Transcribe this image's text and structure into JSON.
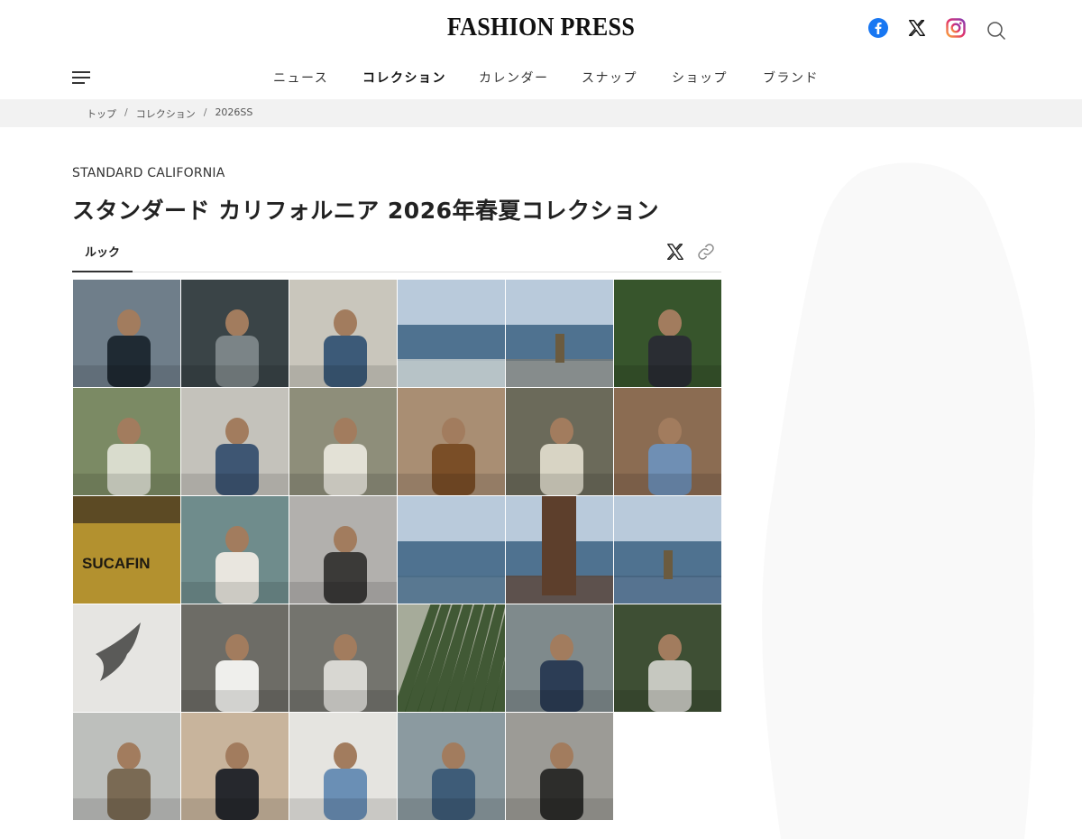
{
  "header": {
    "logo": "FASHION PRESS",
    "social": [
      "facebook-icon",
      "x-icon",
      "instagram-icon"
    ],
    "search_icon": "search-icon"
  },
  "nav": {
    "menu_icon": "menu-icon",
    "items": [
      {
        "label": "ニュース",
        "active": false
      },
      {
        "label": "コレクション",
        "active": true
      },
      {
        "label": "カレンダー",
        "active": false
      },
      {
        "label": "スナップ",
        "active": false
      },
      {
        "label": "ショップ",
        "active": false
      },
      {
        "label": "ブランド",
        "active": false
      }
    ]
  },
  "breadcrumb": [
    "トップ",
    "コレクション",
    "2026SS"
  ],
  "article": {
    "brand_en": "STANDARD CALIFORNIA",
    "title": "スタンダード カリフォルニア 2026年春夏コレクション",
    "tab_label": "ルック",
    "share_icons": [
      "x-share-icon",
      "link-icon"
    ]
  },
  "gallery": {
    "count": 29,
    "photos": [
      {
        "bg": "#6f7e8a",
        "fg": "#1f2a33",
        "label": "",
        "scene": "man-cap"
      },
      {
        "bg": "#3a4447",
        "fg": "#7b8487",
        "label": "",
        "scene": "mat"
      },
      {
        "bg": "#c9c6bc",
        "fg": "#3c5a78",
        "label": "",
        "scene": "car-man"
      },
      {
        "bg": "#6f8fa6",
        "fg": "#d6d8d6",
        "label": "",
        "scene": "coast"
      },
      {
        "bg": "#9fb4c6",
        "fg": "#7c7a74",
        "label": "",
        "scene": "road"
      },
      {
        "bg": "#37552c",
        "fg": "#2a2d33",
        "label": "",
        "scene": "plants-man"
      },
      {
        "bg": "#7b8a64",
        "fg": "#d9dccd",
        "label": "",
        "scene": "grass"
      },
      {
        "bg": "#c4c2bb",
        "fg": "#3e5673",
        "label": "",
        "scene": "sitting"
      },
      {
        "bg": "#8e8e7a",
        "fg": "#e3e1d6",
        "label": "",
        "scene": "sink"
      },
      {
        "bg": "#a98e73",
        "fg": "#7a4e27",
        "label": "",
        "scene": "laundry"
      },
      {
        "bg": "#6b6a5a",
        "fg": "#d8d4c4",
        "label": "",
        "scene": "rail"
      },
      {
        "bg": "#8b6c52",
        "fg": "#6f8fb4",
        "label": "",
        "scene": "bricks"
      },
      {
        "bg": "#5c4a24",
        "fg": "#b3912f",
        "label": "SUCAFIN",
        "scene": "sack"
      },
      {
        "bg": "#6f8c8c",
        "fg": "#e9e6df",
        "label": "",
        "scene": "jacket"
      },
      {
        "bg": "#b2b0ad",
        "fg": "#3b3a38",
        "label": "",
        "scene": "building"
      },
      {
        "bg": "#7c97ad",
        "fg": "#4a6b84",
        "label": "",
        "scene": "sea"
      },
      {
        "bg": "#5f7d99",
        "fg": "#5d3f2c",
        "label": "",
        "scene": "walk"
      },
      {
        "bg": "#7fa2c4",
        "fg": "#455f7a",
        "label": "",
        "scene": "pier"
      },
      {
        "bg": "#e6e5e2",
        "fg": "#5a5a58",
        "label": "",
        "scene": "bird"
      },
      {
        "bg": "#6d6c66",
        "fg": "#efefec",
        "label": "",
        "scene": "van-door"
      },
      {
        "bg": "#74746e",
        "fg": "#d8d7d2",
        "label": "",
        "scene": "van"
      },
      {
        "bg": "#a6ab9a",
        "fg": "#2f4a23",
        "label": "",
        "scene": "leaf"
      },
      {
        "bg": "#7f8a8c",
        "fg": "#2c3d55",
        "label": "",
        "scene": "sofa"
      },
      {
        "bg": "#3e4f34",
        "fg": "#c6c8c0",
        "label": "",
        "scene": "window"
      },
      {
        "bg": "#bdbfbc",
        "fg": "#7a6a54",
        "label": "",
        "scene": "balcony"
      },
      {
        "bg": "#c8b49c",
        "fg": "#26282d",
        "label": "",
        "scene": "couch"
      },
      {
        "bg": "#e5e4e0",
        "fg": "#6a8fb5",
        "label": "",
        "scene": "tee"
      },
      {
        "bg": "#8b9aa0",
        "fg": "#3e5c78",
        "label": "",
        "scene": "cafe"
      },
      {
        "bg": "#9c9b96",
        "fg": "#2d2d2b",
        "label": "",
        "scene": "dash"
      }
    ]
  }
}
